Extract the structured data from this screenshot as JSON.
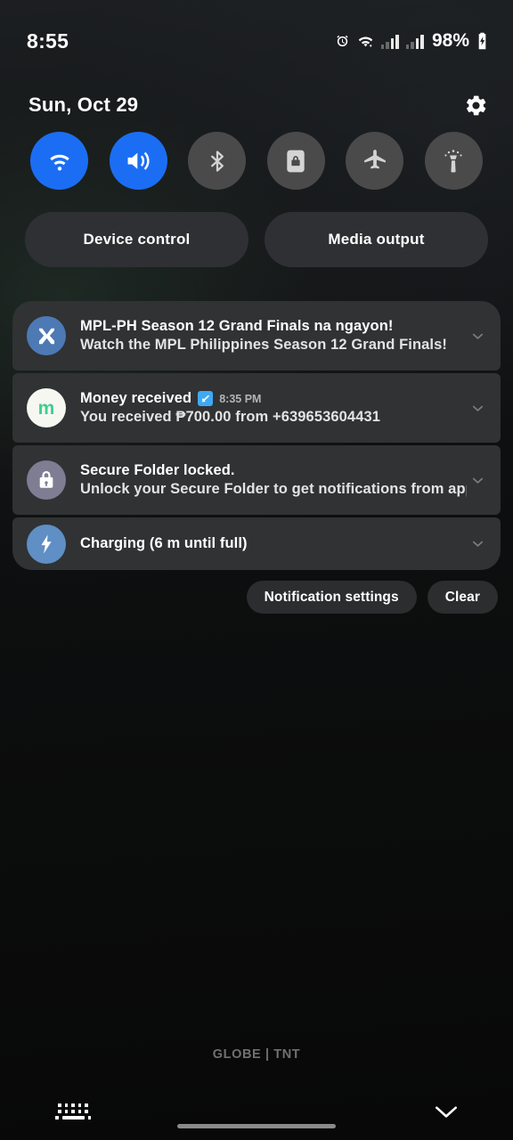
{
  "statusbar": {
    "time": "8:55",
    "battery_percent": "98%",
    "icons": [
      "alarm-icon",
      "wifi-icon",
      "signal-icon-sim1",
      "signal-icon-sim2",
      "battery-charging-icon"
    ]
  },
  "header": {
    "date": "Sun, Oct 29",
    "settings_icon": "gear-icon"
  },
  "quick_settings": {
    "toggles": [
      {
        "name": "wifi",
        "icon": "wifi-icon",
        "active": true,
        "color": "#1b6ef3"
      },
      {
        "name": "sound",
        "icon": "volume-icon",
        "active": true,
        "color": "#1b6ef3"
      },
      {
        "name": "bluetooth",
        "icon": "bluetooth-icon",
        "active": false,
        "color": "#4a4a4a"
      },
      {
        "name": "secure-folder",
        "icon": "lock-folder-icon",
        "active": false,
        "color": "#4a4a4a"
      },
      {
        "name": "airplane-mode",
        "icon": "airplane-icon",
        "active": false,
        "color": "#4a4a4a"
      },
      {
        "name": "flashlight",
        "icon": "flashlight-icon",
        "active": false,
        "color": "#4a4a4a"
      }
    ]
  },
  "shortcuts": {
    "device_control": "Device control",
    "media_output": "Media output"
  },
  "notifications": [
    {
      "id": "mpl",
      "title": "MPL-PH Season 12 Grand Finals na ngayon!",
      "body": "Watch the MPL Philippines Season 12 Grand Finals!",
      "time": "",
      "verified": false,
      "icon": "mpl-logo-icon",
      "icon_bg": "#4d79b5",
      "icon_fg": "#ffffff"
    },
    {
      "id": "money",
      "title": "Money received",
      "body": "You received ₱700.00 from +639653604431",
      "time": "8:35 PM",
      "verified": true,
      "icon": "gcash-logo-icon",
      "icon_bg": "#f7f7f2",
      "icon_fg": "#3ecf8e"
    },
    {
      "id": "secure-folder",
      "title": "Secure Folder locked.",
      "body": "Unlock your Secure Folder to get notifications from app..",
      "time": "",
      "verified": false,
      "icon": "lock-icon",
      "icon_bg": "#7e7d93",
      "icon_fg": "#ffffff"
    },
    {
      "id": "charging",
      "title": "Charging (6 m until full)",
      "body": "",
      "time": "",
      "verified": false,
      "icon": "lightning-bolt-icon",
      "icon_bg": "#5f8fc4",
      "icon_fg": "#ffffff"
    }
  ],
  "actions": {
    "notification_settings": "Notification settings",
    "clear": "Clear"
  },
  "footer": {
    "carrier": "GLOBE | TNT",
    "keyboard_icon": "keyboard-icon",
    "collapse_icon": "chevron-down-icon"
  },
  "colors": {
    "accent": "#1b6ef3",
    "card_bg": "#303234",
    "pill_bg": "#2e3033",
    "toggle_off": "#4a4a4a"
  }
}
